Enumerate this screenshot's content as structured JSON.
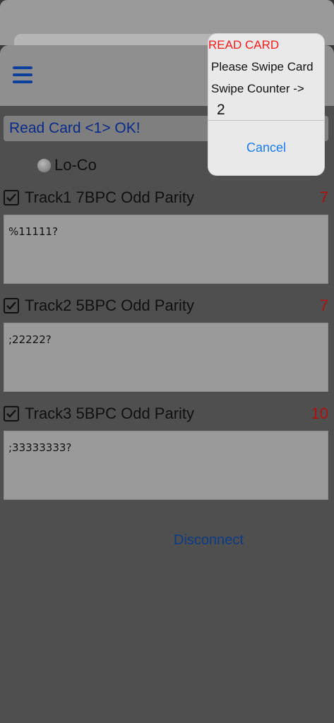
{
  "nav": {
    "menu_icon": "hamburger-menu-icon"
  },
  "status": {
    "text": "Read Card <1> OK!"
  },
  "mode": {
    "label": "Lo-Co",
    "selected": false
  },
  "tracks": [
    {
      "title": "Track1 7BPC Odd Parity",
      "count": "7",
      "data": "%11111?",
      "checked": true
    },
    {
      "title": "Track2 5BPC Odd Parity",
      "count": "7",
      "data": ";22222?",
      "checked": true
    },
    {
      "title": "Track3 5BPC Odd Parity",
      "count": "10",
      "data": ";33333333?",
      "checked": true
    }
  ],
  "actions": {
    "disconnect_label": "Disconnect"
  },
  "alert": {
    "title": "READ CARD",
    "line1": "Please Swipe Card",
    "line2": "Swipe Counter ->",
    "input_value": "2",
    "cancel_label": "Cancel"
  },
  "colors": {
    "status_text": "#0a2a8a",
    "count_red": "#b01010",
    "alert_title_red": "#ff1a1a",
    "cancel_blue": "#1a7cf0",
    "disconnect_blue": "#0b3c86"
  }
}
